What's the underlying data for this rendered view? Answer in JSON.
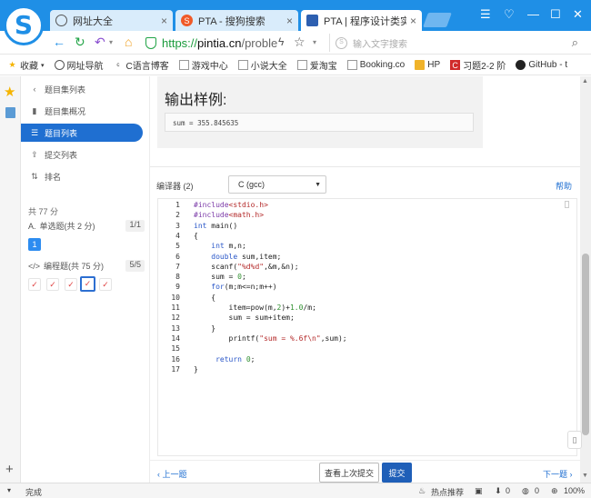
{
  "browser": {
    "tabs": [
      {
        "title": "网址大全",
        "icon": "globe-icon",
        "close": "×"
      },
      {
        "title": "PTA - 搜狗搜索",
        "icon": "sogou-icon",
        "close": "×"
      },
      {
        "title": "PTA | 程序设计类实验辅",
        "icon": "pta-icon",
        "close": "×"
      }
    ],
    "url_prefix": "https://",
    "url_host": "pintia.cn",
    "url_rest": "/proble",
    "search_placeholder": "输入文字搜索",
    "bookmarks": [
      {
        "label": "收藏",
        "icon": "star-icon"
      },
      {
        "label": "网址导航",
        "icon": "globe-icon"
      },
      {
        "label": "C语言博客",
        "icon": "c-icon"
      },
      {
        "label": "游戏中心",
        "icon": "page-icon"
      },
      {
        "label": "小说大全",
        "icon": "page-icon"
      },
      {
        "label": "爱淘宝",
        "icon": "page-icon"
      },
      {
        "label": "Booking.co",
        "icon": "page-icon"
      },
      {
        "label": "HP",
        "icon": "folder-icon"
      },
      {
        "label": "习题2-2 阶",
        "icon": "pta-icon"
      },
      {
        "label": "GitHub - t",
        "icon": "github-icon"
      }
    ],
    "colors": {
      "accent": "#1f8fe6",
      "primary": "#1f6fd1",
      "submit": "#1f5fb8"
    }
  },
  "sidebar": {
    "back_label": "题目集列表",
    "items": [
      {
        "label": "题目集概况",
        "icon": "book-icon"
      },
      {
        "label": "题目列表",
        "icon": "list-icon"
      },
      {
        "label": "提交列表",
        "icon": "upload-icon"
      },
      {
        "label": "排名",
        "icon": "sort-icon"
      }
    ],
    "total": "共 77 分",
    "single_choice": {
      "label": "单选题(共 2 分)",
      "count": "1/1",
      "boxes": [
        "1"
      ]
    },
    "programming": {
      "label": "编程题(共 75 分)",
      "count": "5/5",
      "boxes": [
        "✓",
        "✓",
        "✓",
        "✓",
        "✓"
      ]
    }
  },
  "main": {
    "sample_title": "输出样例:",
    "sample_output": "sum = 355.845635",
    "compiler_label": "编译器 (2)",
    "compiler_value": "C (gcc)",
    "help_label": "帮助",
    "code_lines": [
      "#include<stdio.h>",
      "#include<math.h>",
      "int main()",
      "{",
      "    int m,n;",
      "    double sum,item;",
      "    scanf(\"%d%d\",&m,&n);",
      "    sum = 0;",
      "    for(m;m<=n;m++)",
      "    {",
      "        item=pow(m,2)+1.0/m;",
      "        sum = sum+item;",
      "    }",
      "        printf(\"sum = %.6f\\n\",sum);",
      "",
      "     return 0;",
      "}"
    ],
    "prev_label": "上一题",
    "view_last_label": "查看上次提交",
    "submit_label": "提交",
    "next_label": "下一题"
  },
  "statusbar": {
    "left": "完成",
    "hot": "热点推荐",
    "zero1": "0",
    "zero2": "0",
    "zoom": "100%"
  }
}
